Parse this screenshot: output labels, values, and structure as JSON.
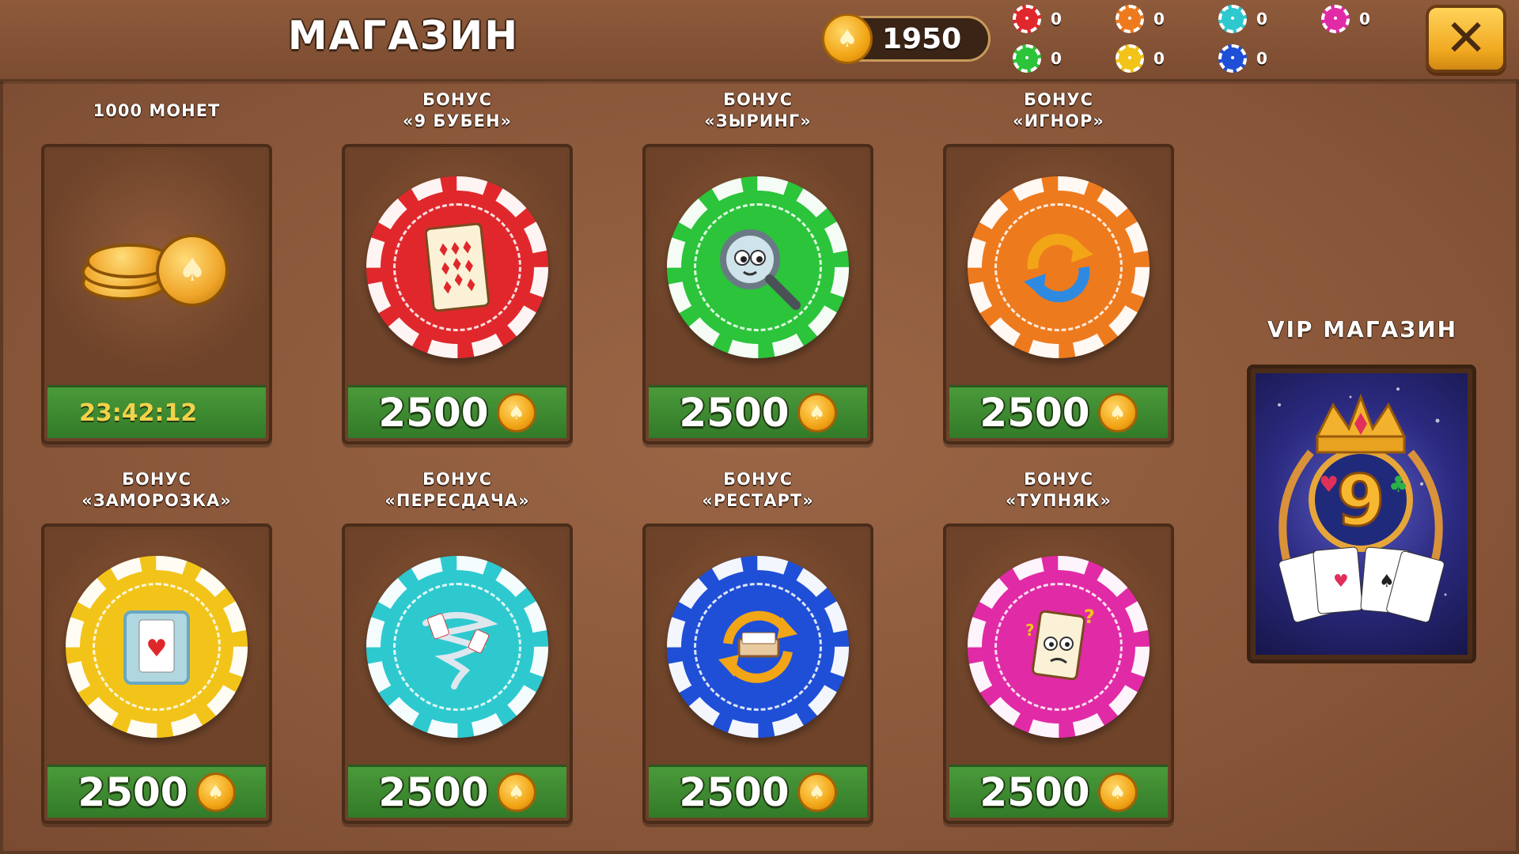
{
  "header": {
    "title": "МАГАЗИН",
    "coins": "1950",
    "close_icon": "close-icon"
  },
  "chip_counters": [
    {
      "color": "#e0282c",
      "count": "0",
      "icon": "card-icon"
    },
    {
      "color": "#ee7a1e",
      "count": "0",
      "icon": "refresh-icon"
    },
    {
      "color": "#2ec9cf",
      "count": "0",
      "icon": "tornado-icon"
    },
    {
      "color": "#e12aa6",
      "count": "0",
      "icon": "confused-card-icon"
    },
    {
      "color": "#2bc43a",
      "count": "0",
      "icon": "magnifier-icon"
    },
    {
      "color": "#f2c41a",
      "count": "0",
      "icon": "ice-card-icon"
    },
    {
      "color": "#1f4fd6",
      "count": "0",
      "icon": "restart-icon"
    }
  ],
  "items": [
    {
      "label1": "1000 МОНЕТ",
      "label2": "",
      "price": "",
      "timer": "23:42:12",
      "chip_color": "",
      "icon": "coins-icon"
    },
    {
      "label1": "БОНУС",
      "label2": "«9 БУБЕН»",
      "price": "2500",
      "chip_color": "#e0282c",
      "icon": "nine-diamonds-card-icon"
    },
    {
      "label1": "БОНУС",
      "label2": "«ЗЫРИНГ»",
      "price": "2500",
      "chip_color": "#2bc43a",
      "icon": "magnifier-icon"
    },
    {
      "label1": "БОНУС",
      "label2": "«ИГНОР»",
      "price": "2500",
      "chip_color": "#ee7a1e",
      "icon": "refresh-arrows-icon"
    },
    {
      "label1": "БОНУС",
      "label2": "«ЗАМОРОЗКА»",
      "price": "2500",
      "chip_color": "#f2c41a",
      "icon": "frozen-card-icon"
    },
    {
      "label1": "БОНУС",
      "label2": "«ПЕРЕСДАЧА»",
      "price": "2500",
      "chip_color": "#2ec9cf",
      "icon": "card-tornado-icon"
    },
    {
      "label1": "БОНУС",
      "label2": "«РЕСТАРТ»",
      "price": "2500",
      "chip_color": "#1f4fd6",
      "icon": "deck-restart-icon"
    },
    {
      "label1": "БОНУС",
      "label2": "«ТУПНЯК»",
      "price": "2500",
      "chip_color": "#e12aa6",
      "icon": "confused-card-icon"
    }
  ],
  "vip": {
    "label": "VIP МАГАЗИН",
    "icon": "vip-crown-nine-icon"
  }
}
